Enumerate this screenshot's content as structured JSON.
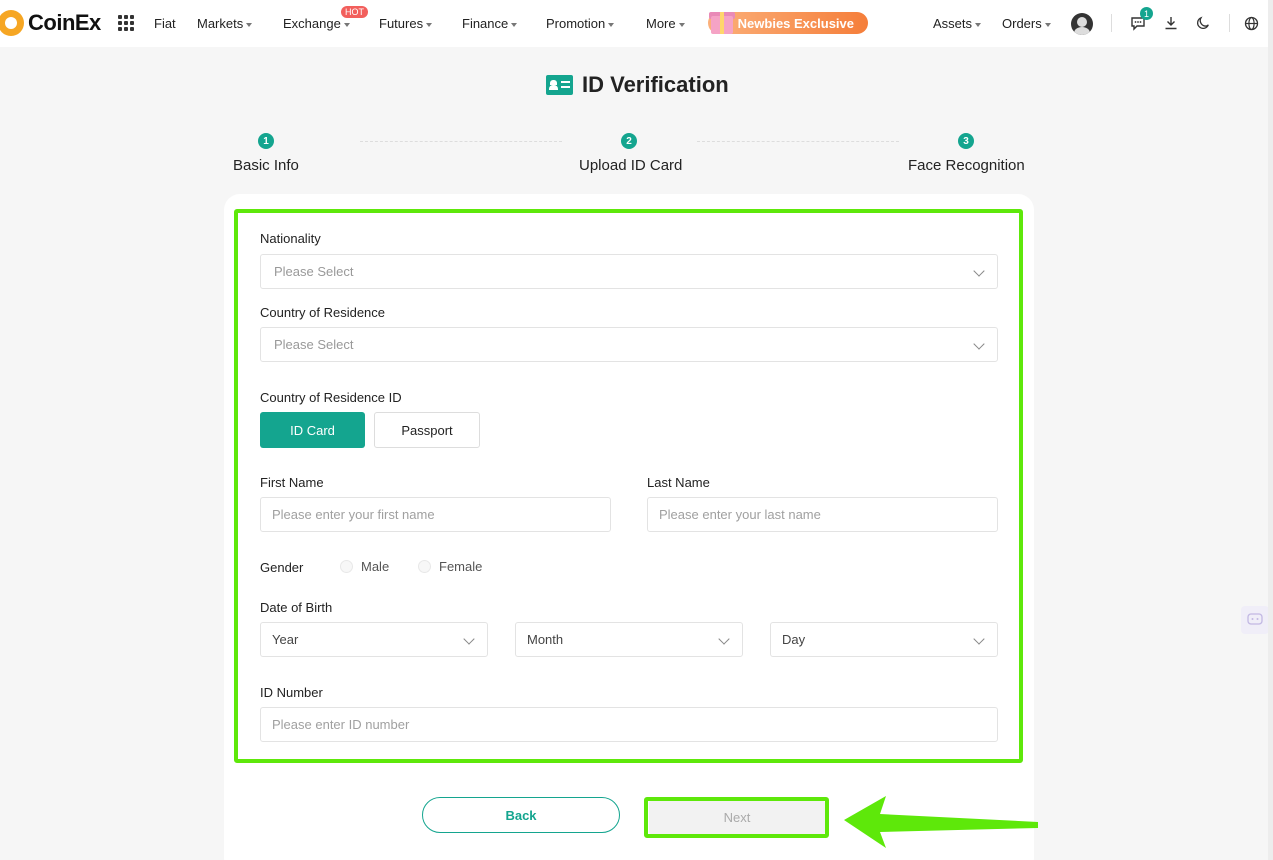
{
  "app": {
    "name": "CoinEx"
  },
  "nav": {
    "items": [
      {
        "label": "Fiat",
        "has_caret": false
      },
      {
        "label": "Markets",
        "has_caret": true
      },
      {
        "label": "Exchange",
        "has_caret": true
      },
      {
        "label": "Futures",
        "has_caret": true
      },
      {
        "label": "Finance",
        "has_caret": true
      },
      {
        "label": "Promotion",
        "has_caret": true
      },
      {
        "label": "More",
        "has_caret": true
      }
    ],
    "hot_badge": "HOT",
    "promo": "Newbies Exclusive",
    "right_items": [
      {
        "label": "Assets"
      },
      {
        "label": "Orders"
      }
    ],
    "message_count": "1"
  },
  "page": {
    "title": "ID Verification"
  },
  "steps": [
    {
      "number": "1",
      "label": "Basic Info"
    },
    {
      "number": "2",
      "label": "Upload ID Card"
    },
    {
      "number": "3",
      "label": "Face Recognition"
    }
  ],
  "form": {
    "nationality": {
      "label": "Nationality",
      "placeholder": "Please Select"
    },
    "residence": {
      "label": "Country of Residence",
      "placeholder": "Please Select"
    },
    "residence_id": {
      "label": "Country of Residence ID",
      "options": [
        "ID Card",
        "Passport"
      ],
      "selected": "ID Card"
    },
    "first_name": {
      "label": "First Name",
      "placeholder": "Please enter your first name"
    },
    "last_name": {
      "label": "Last Name",
      "placeholder": "Please enter your last name"
    },
    "gender": {
      "label": "Gender",
      "options": [
        "Male",
        "Female"
      ]
    },
    "dob": {
      "label": "Date of Birth",
      "year": "Year",
      "month": "Month",
      "day": "Day"
    },
    "id_number": {
      "label": "ID Number",
      "placeholder": "Please enter ID number"
    }
  },
  "actions": {
    "back": "Back",
    "next": "Next"
  },
  "colors": {
    "accent": "#14a58f",
    "highlight": "#5ee80a",
    "promo": "#f57e3a",
    "hot": "#f25f5c"
  }
}
